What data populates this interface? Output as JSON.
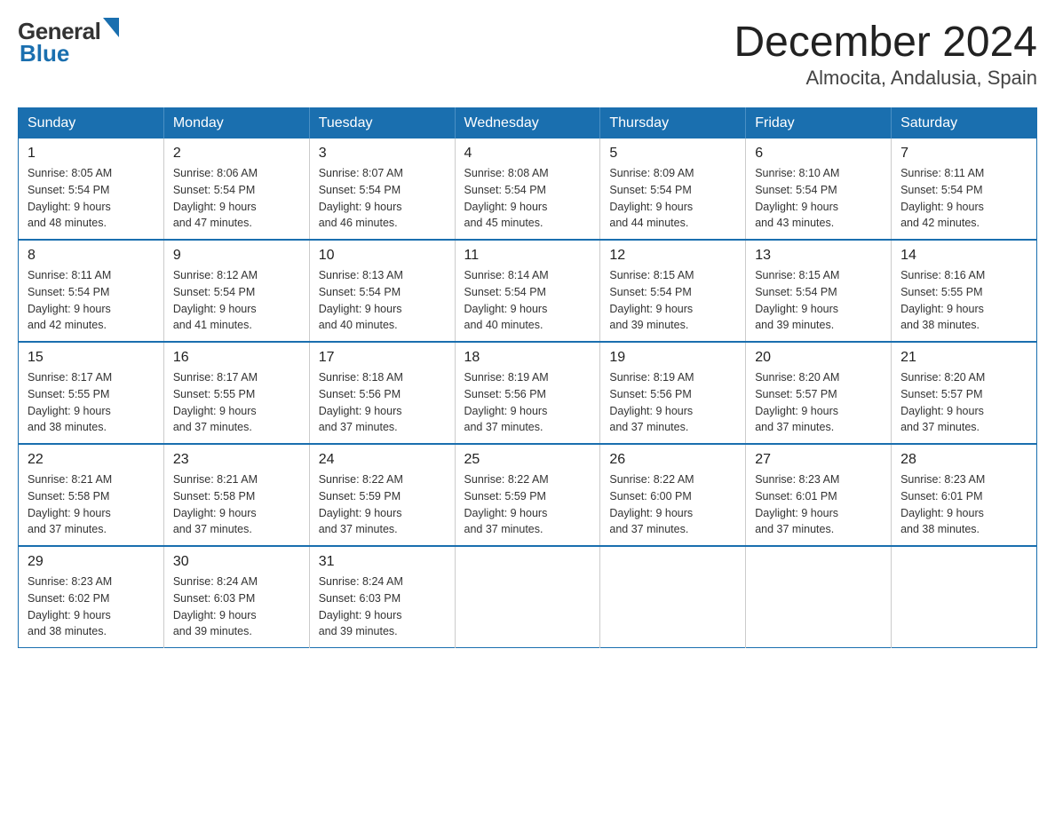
{
  "header": {
    "title": "December 2024",
    "subtitle": "Almocita, Andalusia, Spain"
  },
  "logo": {
    "general": "General",
    "blue": "Blue"
  },
  "days_of_week": [
    "Sunday",
    "Monday",
    "Tuesday",
    "Wednesday",
    "Thursday",
    "Friday",
    "Saturday"
  ],
  "weeks": [
    [
      {
        "day": "1",
        "sunrise": "8:05 AM",
        "sunset": "5:54 PM",
        "daylight": "9 hours and 48 minutes."
      },
      {
        "day": "2",
        "sunrise": "8:06 AM",
        "sunset": "5:54 PM",
        "daylight": "9 hours and 47 minutes."
      },
      {
        "day": "3",
        "sunrise": "8:07 AM",
        "sunset": "5:54 PM",
        "daylight": "9 hours and 46 minutes."
      },
      {
        "day": "4",
        "sunrise": "8:08 AM",
        "sunset": "5:54 PM",
        "daylight": "9 hours and 45 minutes."
      },
      {
        "day": "5",
        "sunrise": "8:09 AM",
        "sunset": "5:54 PM",
        "daylight": "9 hours and 44 minutes."
      },
      {
        "day": "6",
        "sunrise": "8:10 AM",
        "sunset": "5:54 PM",
        "daylight": "9 hours and 43 minutes."
      },
      {
        "day": "7",
        "sunrise": "8:11 AM",
        "sunset": "5:54 PM",
        "daylight": "9 hours and 42 minutes."
      }
    ],
    [
      {
        "day": "8",
        "sunrise": "8:11 AM",
        "sunset": "5:54 PM",
        "daylight": "9 hours and 42 minutes."
      },
      {
        "day": "9",
        "sunrise": "8:12 AM",
        "sunset": "5:54 PM",
        "daylight": "9 hours and 41 minutes."
      },
      {
        "day": "10",
        "sunrise": "8:13 AM",
        "sunset": "5:54 PM",
        "daylight": "9 hours and 40 minutes."
      },
      {
        "day": "11",
        "sunrise": "8:14 AM",
        "sunset": "5:54 PM",
        "daylight": "9 hours and 40 minutes."
      },
      {
        "day": "12",
        "sunrise": "8:15 AM",
        "sunset": "5:54 PM",
        "daylight": "9 hours and 39 minutes."
      },
      {
        "day": "13",
        "sunrise": "8:15 AM",
        "sunset": "5:54 PM",
        "daylight": "9 hours and 39 minutes."
      },
      {
        "day": "14",
        "sunrise": "8:16 AM",
        "sunset": "5:55 PM",
        "daylight": "9 hours and 38 minutes."
      }
    ],
    [
      {
        "day": "15",
        "sunrise": "8:17 AM",
        "sunset": "5:55 PM",
        "daylight": "9 hours and 38 minutes."
      },
      {
        "day": "16",
        "sunrise": "8:17 AM",
        "sunset": "5:55 PM",
        "daylight": "9 hours and 37 minutes."
      },
      {
        "day": "17",
        "sunrise": "8:18 AM",
        "sunset": "5:56 PM",
        "daylight": "9 hours and 37 minutes."
      },
      {
        "day": "18",
        "sunrise": "8:19 AM",
        "sunset": "5:56 PM",
        "daylight": "9 hours and 37 minutes."
      },
      {
        "day": "19",
        "sunrise": "8:19 AM",
        "sunset": "5:56 PM",
        "daylight": "9 hours and 37 minutes."
      },
      {
        "day": "20",
        "sunrise": "8:20 AM",
        "sunset": "5:57 PM",
        "daylight": "9 hours and 37 minutes."
      },
      {
        "day": "21",
        "sunrise": "8:20 AM",
        "sunset": "5:57 PM",
        "daylight": "9 hours and 37 minutes."
      }
    ],
    [
      {
        "day": "22",
        "sunrise": "8:21 AM",
        "sunset": "5:58 PM",
        "daylight": "9 hours and 37 minutes."
      },
      {
        "day": "23",
        "sunrise": "8:21 AM",
        "sunset": "5:58 PM",
        "daylight": "9 hours and 37 minutes."
      },
      {
        "day": "24",
        "sunrise": "8:22 AM",
        "sunset": "5:59 PM",
        "daylight": "9 hours and 37 minutes."
      },
      {
        "day": "25",
        "sunrise": "8:22 AM",
        "sunset": "5:59 PM",
        "daylight": "9 hours and 37 minutes."
      },
      {
        "day": "26",
        "sunrise": "8:22 AM",
        "sunset": "6:00 PM",
        "daylight": "9 hours and 37 minutes."
      },
      {
        "day": "27",
        "sunrise": "8:23 AM",
        "sunset": "6:01 PM",
        "daylight": "9 hours and 37 minutes."
      },
      {
        "day": "28",
        "sunrise": "8:23 AM",
        "sunset": "6:01 PM",
        "daylight": "9 hours and 38 minutes."
      }
    ],
    [
      {
        "day": "29",
        "sunrise": "8:23 AM",
        "sunset": "6:02 PM",
        "daylight": "9 hours and 38 minutes."
      },
      {
        "day": "30",
        "sunrise": "8:24 AM",
        "sunset": "6:03 PM",
        "daylight": "9 hours and 39 minutes."
      },
      {
        "day": "31",
        "sunrise": "8:24 AM",
        "sunset": "6:03 PM",
        "daylight": "9 hours and 39 minutes."
      },
      null,
      null,
      null,
      null
    ]
  ],
  "labels": {
    "sunrise": "Sunrise:",
    "sunset": "Sunset:",
    "daylight": "Daylight:"
  }
}
